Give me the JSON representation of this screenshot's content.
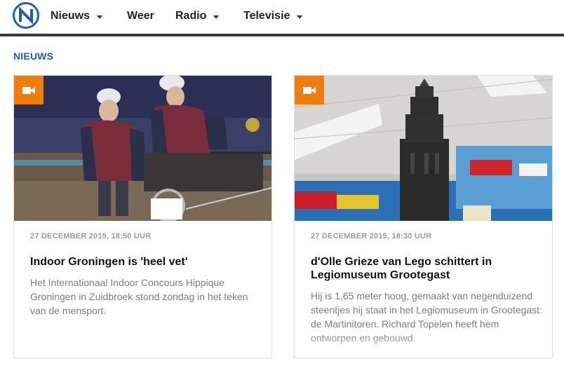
{
  "header": {
    "logo_icon": "rtv-noord-logo-icon",
    "nav": [
      {
        "label": "Nieuws",
        "has_dropdown": true
      },
      {
        "label": "Weer",
        "has_dropdown": false
      },
      {
        "label": "Radio",
        "has_dropdown": true
      },
      {
        "label": "Televisie",
        "has_dropdown": true
      }
    ]
  },
  "section": {
    "label": "NIEUWS"
  },
  "articles": [
    {
      "type_icon": "video-camera-icon",
      "image": "two riders in driving carriage at indoor horse event",
      "date": "27 DECEMBER 2015, 18:50 UUR",
      "title": "Indoor Groningen is 'heel vet'",
      "text": "Het Internationaal Indoor Concours Hippique Groningen in Zuidbroek stond zondag in het teken van de mensport."
    },
    {
      "type_icon": "video-camera-icon",
      "image": "Lego model of Martinitoren in museum",
      "date": "27 DECEMBER 2015, 18:30 UUR",
      "title": "d'Olle Grieze van Lego schittert in Legiomuseum Grootegast",
      "text": "Hij is 1,65 meter hoog, gemaakt van negenduizend steentjes hij staat in het Legiomuseum in Grootegast: de Martinitoren. Richard Topelen heeft hem ontworpen en gebouwd."
    }
  ],
  "colors": {
    "accent": "#1f5fa8",
    "badge": "#ee7d10",
    "text_muted": "#7d7d7d"
  }
}
